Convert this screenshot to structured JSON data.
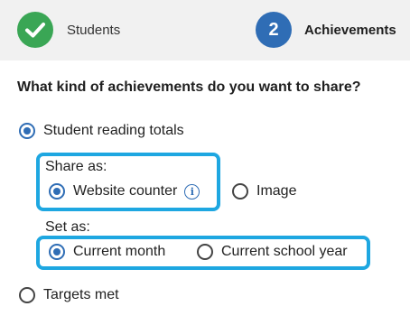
{
  "stepper": {
    "steps": [
      {
        "label": "Students",
        "state": "done",
        "icon": "checkmark-icon",
        "color": "#3aa655"
      },
      {
        "number": "2",
        "label": "Achievements",
        "state": "active",
        "color": "#2f6db5"
      }
    ]
  },
  "question": "What kind of achievements do you want to share?",
  "options": {
    "reading_totals": {
      "label": "Student reading totals",
      "checked": true
    },
    "targets_met": {
      "label": "Targets met",
      "checked": false
    }
  },
  "share_as": {
    "label": "Share as:",
    "options": [
      {
        "label": "Website counter",
        "checked": true,
        "info_icon": "info-icon"
      },
      {
        "label": "Image",
        "checked": false
      }
    ]
  },
  "set_as": {
    "label": "Set as:",
    "options": [
      {
        "label": "Current month",
        "checked": true
      },
      {
        "label": "Current school year",
        "checked": false
      }
    ]
  },
  "colors": {
    "accent": "#2f6db5",
    "success": "#3aa655",
    "highlight": "#1ea7e1",
    "header_bg": "#f1f1f1"
  }
}
